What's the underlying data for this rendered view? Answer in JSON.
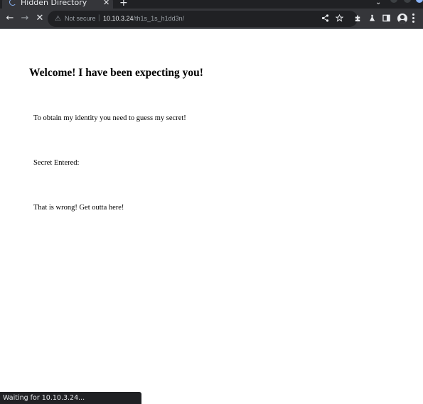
{
  "tab": {
    "title": "Hidden Directory",
    "close_glyph": "✕",
    "new_tab_glyph": "+",
    "tab_search_glyph": "⌄"
  },
  "toolbar": {
    "back_glyph": "←",
    "forward_glyph": "→",
    "stop_glyph": "✕",
    "security_icon": "⚠",
    "security_label": "Not secure",
    "separator": "|",
    "url_host": "10.10.3.24",
    "url_path": "/th1s_1s_h1dd3n/"
  },
  "page": {
    "heading": "Welcome! I have been expecting you!",
    "intro": "To obtain my identity you need to guess my secret!",
    "secret_label": "Secret Entered:",
    "result": "That is wrong! Get outta here!"
  },
  "status_bar": {
    "text": "Waiting for 10.10.3.24..."
  },
  "icons": [
    "favicon-icon",
    "warning-icon",
    "share-icon",
    "star-icon",
    "extensions-icon",
    "labs-icon",
    "side-panel-icon",
    "profile-icon",
    "menu-icon"
  ],
  "colors": {
    "titlebar": "#202124",
    "toolbar": "#35363a",
    "omnibox": "#202124",
    "toolbar_text": "#e8eaed",
    "muted_text": "#9aa0a6",
    "page_bg": "#ffffff"
  }
}
